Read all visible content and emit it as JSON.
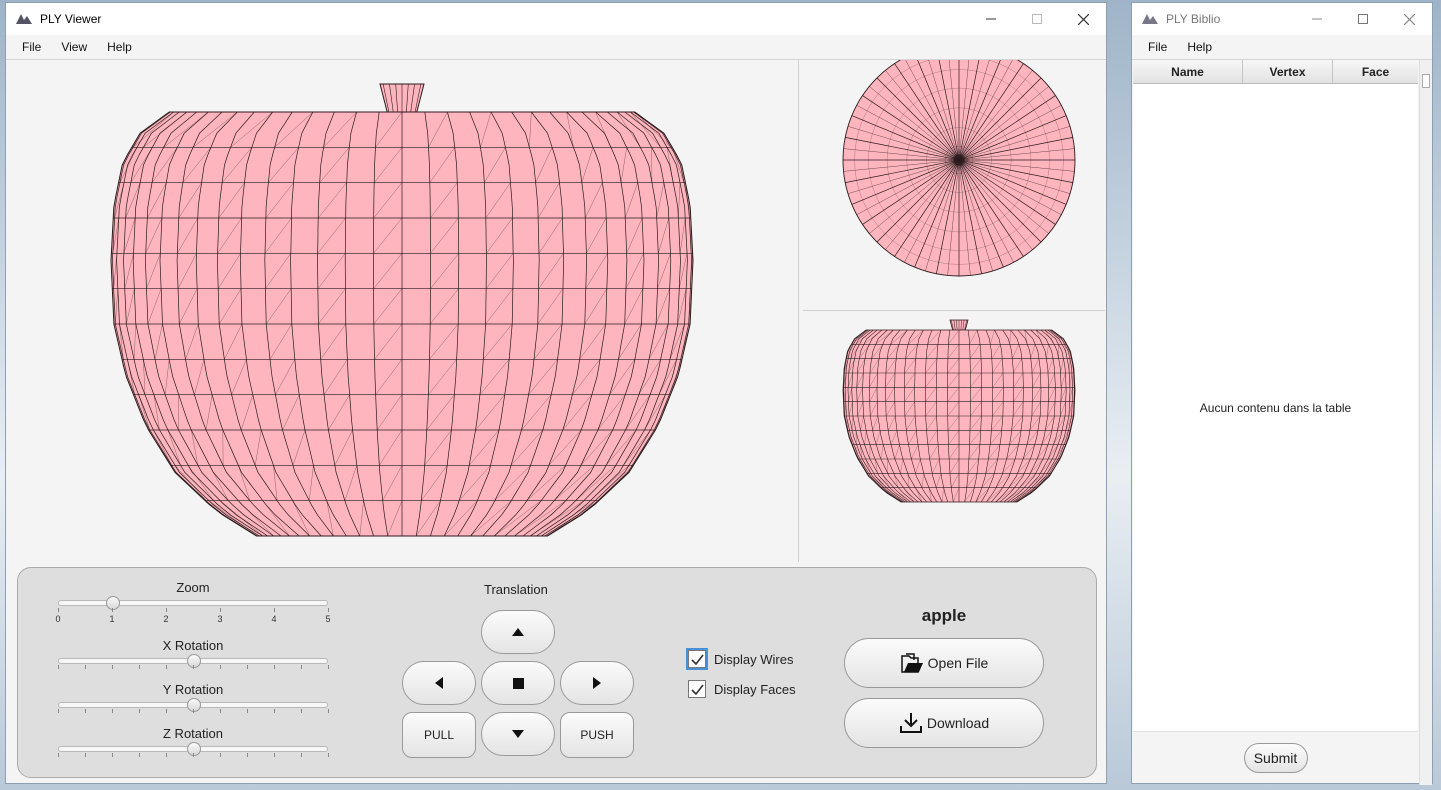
{
  "viewer": {
    "title": "PLY Viewer",
    "menu": [
      "File",
      "View",
      "Help"
    ],
    "zoom": {
      "label": "Zoom",
      "value": 1,
      "min": 0,
      "max": 5,
      "tick_labels": [
        "0",
        "1",
        "2",
        "3",
        "4",
        "5"
      ]
    },
    "rotations": [
      {
        "label": "X Rotation",
        "value": 0.5
      },
      {
        "label": "Y Rotation",
        "value": 0.5
      },
      {
        "label": "Z Rotation",
        "value": 0.5
      }
    ],
    "translation": {
      "label": "Translation",
      "pull_label": "PULL",
      "push_label": "PUSH"
    },
    "display_wires": {
      "label": "Display Wires",
      "checked": true
    },
    "display_faces": {
      "label": "Display Faces",
      "checked": true
    },
    "model_name": "apple",
    "open_file_label": "Open File",
    "download_label": "Download",
    "mesh_fill": "#ffb5be",
    "mesh_stroke": "#2a1a1c"
  },
  "biblio": {
    "title": "PLY Biblio",
    "menu": [
      "File",
      "Help"
    ],
    "columns": [
      "Name",
      "Vertex",
      "Face"
    ],
    "empty_text": "Aucun contenu dans la table",
    "submit_label": "Submit"
  }
}
